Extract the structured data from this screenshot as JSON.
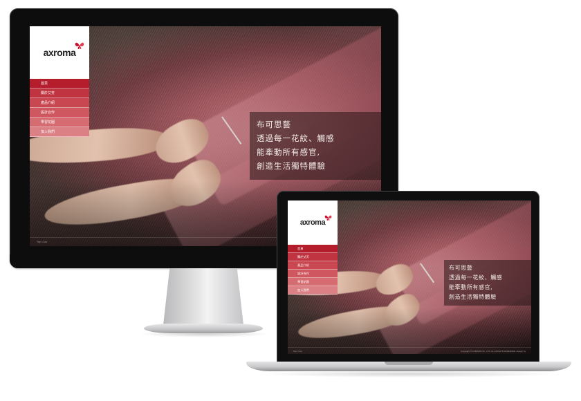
{
  "site": {
    "logo_text": "axroma",
    "logo_mark": "butterfly-logo",
    "nav": [
      "首頁",
      "關於艾芳",
      "產品介紹",
      "設計合作",
      "學習花園",
      "加入我們"
    ],
    "tagline": [
      "布可思藝",
      "透過每一花紋、觸感",
      "能牽動所有感官,",
      "創造生活獨特體驗"
    ],
    "footer_left": "Top / Con",
    "footer_right": "Copyright © AXROMA CO., LTD. ALL RIGHTS RESERVED. Design by"
  },
  "colors": {
    "brand_red": "#b41e2c",
    "nav_gradient": [
      "#b41e2c",
      "#bf3440",
      "#c94750",
      "#cf5860",
      "#d56c72",
      "#db8084"
    ],
    "tagline_bg": "#28161a"
  }
}
